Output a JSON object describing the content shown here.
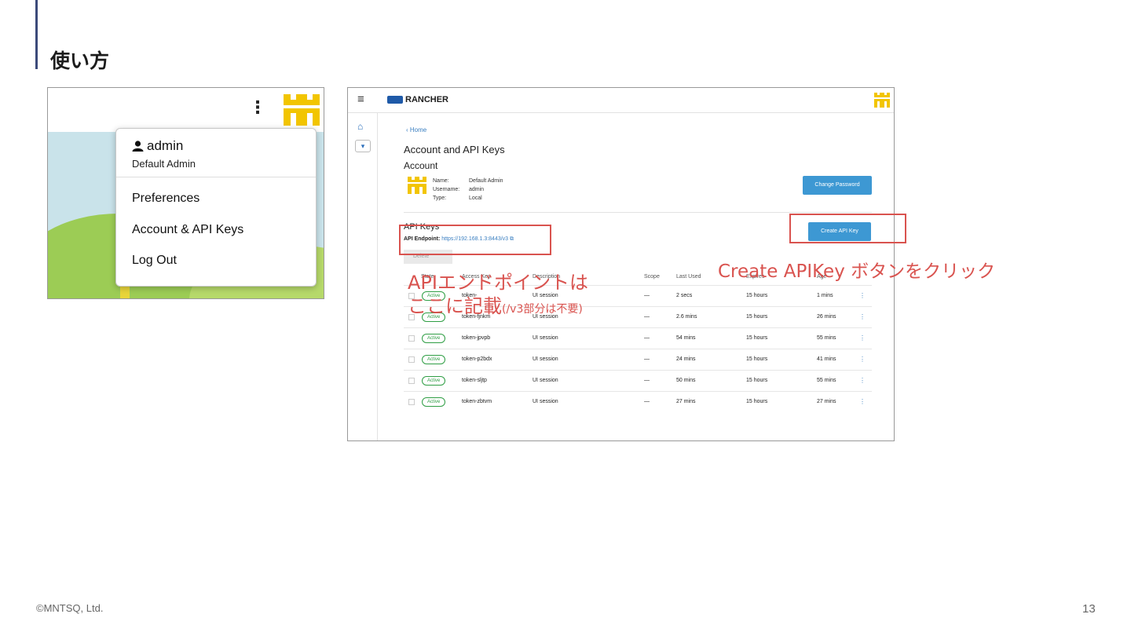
{
  "slide": {
    "title": "使い方",
    "footer": "©MNTSQ, Ltd.",
    "page_number": "13"
  },
  "user_menu": {
    "kebab": "⋮",
    "user_name": "admin",
    "user_role": "Default Admin",
    "items": [
      "Preferences",
      "Account & API Keys",
      "Log Out"
    ]
  },
  "rancher": {
    "brand": "RANCHER",
    "breadcrumb": "‹ Home",
    "page_title": "Account and API Keys",
    "account_heading": "Account",
    "account_info": {
      "name_label": "Name:",
      "name_value": "Default Admin",
      "username_label": "Username:",
      "username_value": "admin",
      "type_label": "Type:",
      "type_value": "Local"
    },
    "change_password_label": "Change Password",
    "api_keys_heading": "API Keys",
    "endpoint_label": "API Endpoint:",
    "endpoint_url": "https://192.168.1.3:8443/v3",
    "copy_icon": "⧉",
    "create_api_key_label": "Create API Key",
    "delete_label": "Delete",
    "table": {
      "headers": [
        "State",
        "Access Key",
        "Description",
        "Scope",
        "Last Used",
        "Expires",
        "Age"
      ],
      "rows": [
        {
          "state": "Active",
          "key": "token-",
          "description": "UI session",
          "scope": "—",
          "last_used": "2 secs",
          "expires": "15 hours",
          "age": "1 mins"
        },
        {
          "state": "Active",
          "key": "token-fjnkm",
          "description": "UI session",
          "scope": "—",
          "last_used": "2.6 mins",
          "expires": "15 hours",
          "age": "26 mins"
        },
        {
          "state": "Active",
          "key": "token-jpvpb",
          "description": "UI session",
          "scope": "—",
          "last_used": "54 mins",
          "expires": "15 hours",
          "age": "55 mins"
        },
        {
          "state": "Active",
          "key": "token-p2bdx",
          "description": "UI session",
          "scope": "—",
          "last_used": "24 mins",
          "expires": "15 hours",
          "age": "41 mins"
        },
        {
          "state": "Active",
          "key": "token-sljtp",
          "description": "UI session",
          "scope": "—",
          "last_used": "50 mins",
          "expires": "15 hours",
          "age": "55 mins"
        },
        {
          "state": "Active",
          "key": "token-zbtvm",
          "description": "UI session",
          "scope": "—",
          "last_used": "27 mins",
          "expires": "15 hours",
          "age": "27 mins"
        }
      ]
    }
  },
  "annotations": {
    "endpoint_line1": "APIエンドポイントは",
    "endpoint_line2": "ここに記載",
    "endpoint_note": "(/v3部分は不要)",
    "create_button_note": "Create APIKey ボタンをクリック"
  }
}
